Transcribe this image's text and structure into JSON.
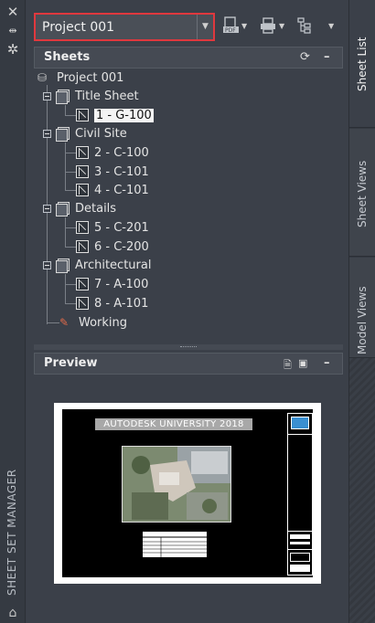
{
  "palette": {
    "statusRed": "#e0383e",
    "selectionBg": "#f4f4f4",
    "tbLogo": "#3a8fd0"
  },
  "strip": {
    "title": "SHEET SET MANAGER",
    "icons": [
      "close-icon",
      "auto-hide-icon",
      "properties-icon",
      "sheet-set-icon"
    ]
  },
  "toolbar": {
    "project_value": "Project 001",
    "icons": [
      "publish-pdf-icon",
      "plot-icon",
      "sheet-set-tools-icon"
    ]
  },
  "sheets_panel": {
    "title": "Sheets",
    "root": "Project 001",
    "subsets": [
      {
        "name": "Title Sheet",
        "sheets": [
          "1 - G-100"
        ]
      },
      {
        "name": "Civil Site",
        "sheets": [
          "2 - C-100",
          "3 - C-101",
          "4 - C-101"
        ]
      },
      {
        "name": "Details",
        "sheets": [
          "5 - C-201",
          "6 - C-200"
        ]
      },
      {
        "name": "Architectural",
        "sheets": [
          "7 - A-100",
          "8 - A-101"
        ]
      }
    ],
    "working": "Working",
    "selected": "1 - G-100"
  },
  "preview_panel": {
    "title": "Preview",
    "sheet_title": "AUTODESK UNIVERSITY 2018"
  },
  "right_tabs": [
    "Sheet List",
    "Sheet Views",
    "Model Views"
  ]
}
